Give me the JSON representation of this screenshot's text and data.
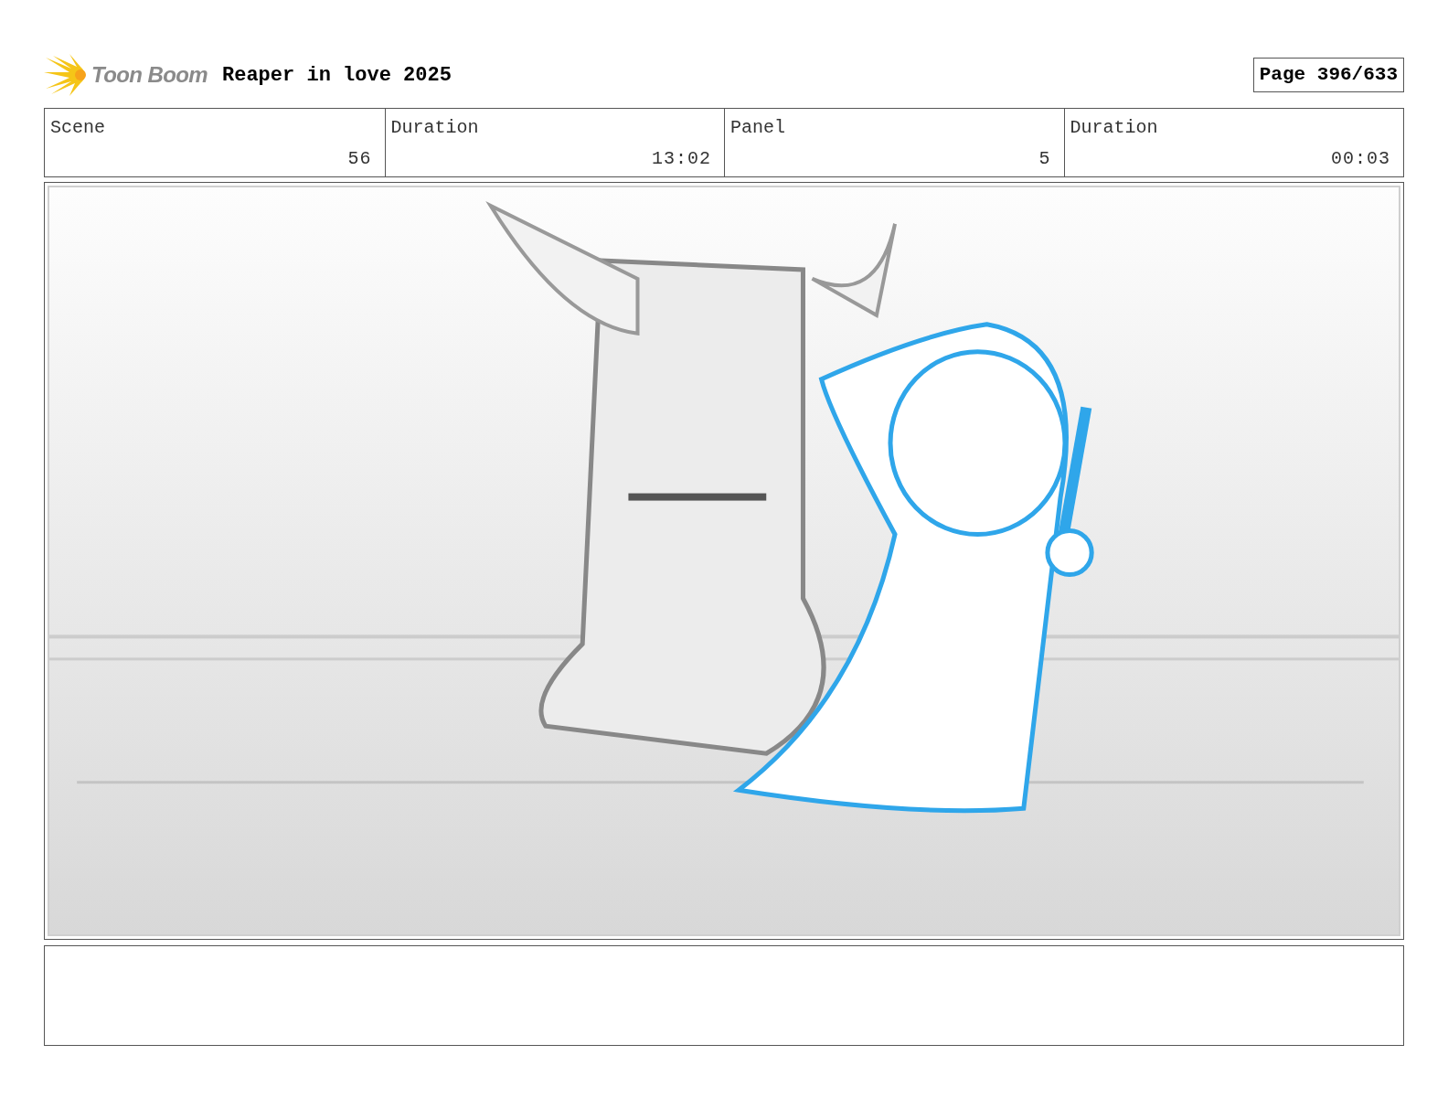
{
  "header": {
    "logo_text": "Toon Boom",
    "project_title": "Reaper in love 2025",
    "page": "Page 396/633"
  },
  "info": [
    {
      "label": "Scene",
      "value": "56"
    },
    {
      "label": "Duration",
      "value": "13:02"
    },
    {
      "label": "Panel",
      "value": "5"
    },
    {
      "label": "Duration",
      "value": "00:03"
    }
  ]
}
